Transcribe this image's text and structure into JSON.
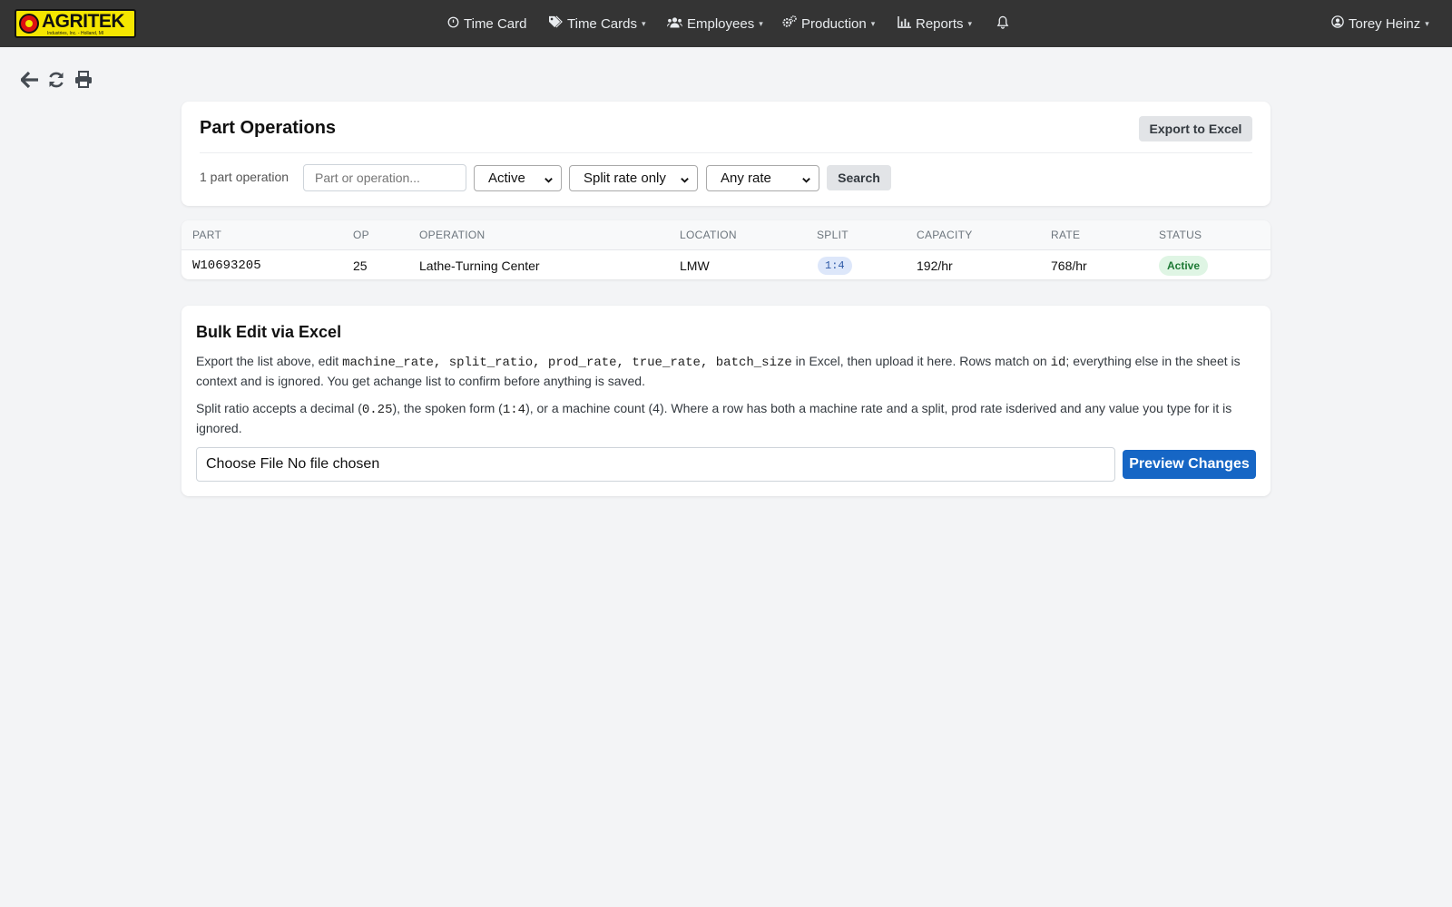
{
  "brand": {
    "name": "AGRITEK",
    "tagline": "Industries, Inc. - Holland, MI"
  },
  "nav": {
    "items": [
      {
        "label": "Time Card",
        "icon": "clock-icon",
        "has_caret": false
      },
      {
        "label": "Time Cards",
        "icon": "tags-icon",
        "has_caret": true
      },
      {
        "label": "Employees",
        "icon": "users-icon",
        "has_caret": true
      },
      {
        "label": "Production",
        "icon": "gears-icon",
        "has_caret": true
      },
      {
        "label": "Reports",
        "icon": "bar-chart-icon",
        "has_caret": true
      }
    ],
    "notifications_icon": "bell-icon",
    "user": {
      "name": "Torey Heinz",
      "icon": "user-circle-icon"
    },
    "caret": "▾"
  },
  "toolbar": {
    "icons": [
      "back-arrow-icon",
      "refresh-icon",
      "print-icon"
    ]
  },
  "part_operations": {
    "title": "Part Operations",
    "export_label": "Export to Excel",
    "count_label": "1 part operation",
    "search_placeholder": "Part or operation...",
    "status_filter": "Active",
    "split_filter": "Split rate only",
    "rate_filter": "Any rate",
    "search_label": "Search"
  },
  "table": {
    "headers": [
      "PART",
      "OP",
      "OPERATION",
      "LOCATION",
      "SPLIT",
      "CAPACITY",
      "RATE",
      "STATUS"
    ],
    "rows": [
      {
        "part": "W10693205",
        "op": "25",
        "operation": "Lathe-Turning Center",
        "location": "LMW",
        "split": "1:4",
        "capacity": "192/hr",
        "rate": "768/hr",
        "status": "Active"
      }
    ]
  },
  "bulk_edit": {
    "title": "Bulk Edit via Excel",
    "p1": {
      "t1": "Export the list above, edit ",
      "c1": "machine_rate, split_ratio, prod_rate, true_rate, batch_size",
      "t2": " in Excel, then upload it here. Rows match on ",
      "c2": "id",
      "t3": "; everything else in the sheet is context and is ignored. You get achange list to confirm before anything is saved."
    },
    "p2": {
      "t1": "Split ratio accepts a decimal (",
      "c1": "0.25",
      "t2": "), the spoken form (",
      "c2": "1:4",
      "t3": "), or a machine count (",
      "c3": "4",
      "t4": "). Where a row has both a machine rate and a split, prod rate isderived and any value you type for it is ignored."
    },
    "file_label": "Choose File No file chosen",
    "preview_label": "Preview Changes"
  },
  "colors": {
    "navbar": "#343434",
    "primary": "#1666c5",
    "active_badge_bg": "#dff5e4",
    "active_badge_text": "#1e7a35",
    "split_badge_bg": "#dde7fa"
  }
}
